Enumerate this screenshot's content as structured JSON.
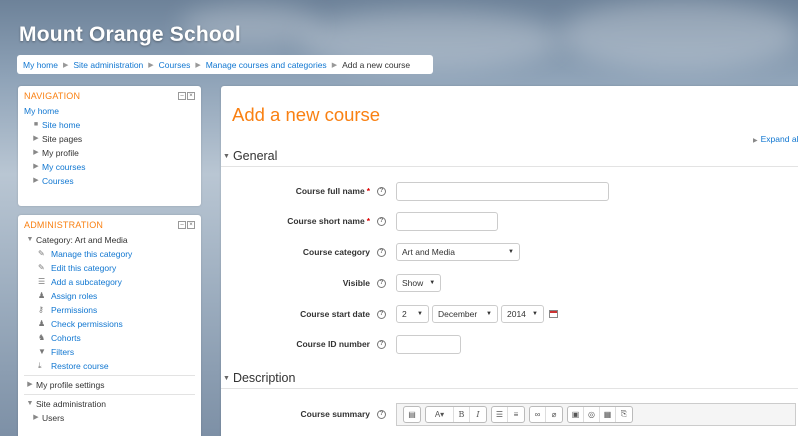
{
  "header": {
    "site_title": "Mount Orange School"
  },
  "breadcrumb": [
    "My home",
    "Site administration",
    "Courses",
    "Manage courses and categories",
    "Add a new course"
  ],
  "navigation": {
    "title": "NAVIGATION",
    "top_link": "My home",
    "items": [
      "Site home",
      "Site pages",
      "My profile",
      "My courses",
      "Courses"
    ]
  },
  "administration": {
    "title": "ADMINISTRATION",
    "category_label": "Category: Art and Media",
    "category_items": [
      "Manage this category",
      "Edit this category",
      "Add a subcategory",
      "Assign roles",
      "Permissions",
      "Check permissions",
      "Cohorts",
      "Filters",
      "Restore course"
    ],
    "profile_settings": "My profile settings",
    "site_admin": "Site administration",
    "site_admin_items": [
      "Users"
    ]
  },
  "main": {
    "heading": "Add a new course",
    "expand_all": "Expand all",
    "sections": {
      "general": "General",
      "description": "Description"
    },
    "fields": {
      "full_name": {
        "label": "Course full name",
        "value": ""
      },
      "short_name": {
        "label": "Course short name",
        "value": ""
      },
      "category": {
        "label": "Course category",
        "value": "Art and Media"
      },
      "visible": {
        "label": "Visible",
        "value": "Show"
      },
      "start_date": {
        "label": "Course start date",
        "day": "2",
        "month": "December",
        "year": "2014"
      },
      "id_number": {
        "label": "Course ID number",
        "value": ""
      },
      "summary": {
        "label": "Course summary"
      }
    },
    "required_mark": "*",
    "help_glyph": "?"
  },
  "icons": {
    "block_controls": [
      "dock-icon",
      "hide-block-icon"
    ],
    "editor_toolbar": [
      "toolbar-toggle-icon",
      "font-style-icon",
      "bold-icon",
      "italic-icon",
      "unordered-list-icon",
      "ordered-list-icon",
      "link-icon",
      "unlink-icon",
      "image-icon",
      "media-icon",
      "manage-files-icon",
      "paste-icon"
    ]
  },
  "colors": {
    "accent_orange": "#f98012",
    "link_blue": "#1177d1",
    "required_red": "#dd0000"
  }
}
